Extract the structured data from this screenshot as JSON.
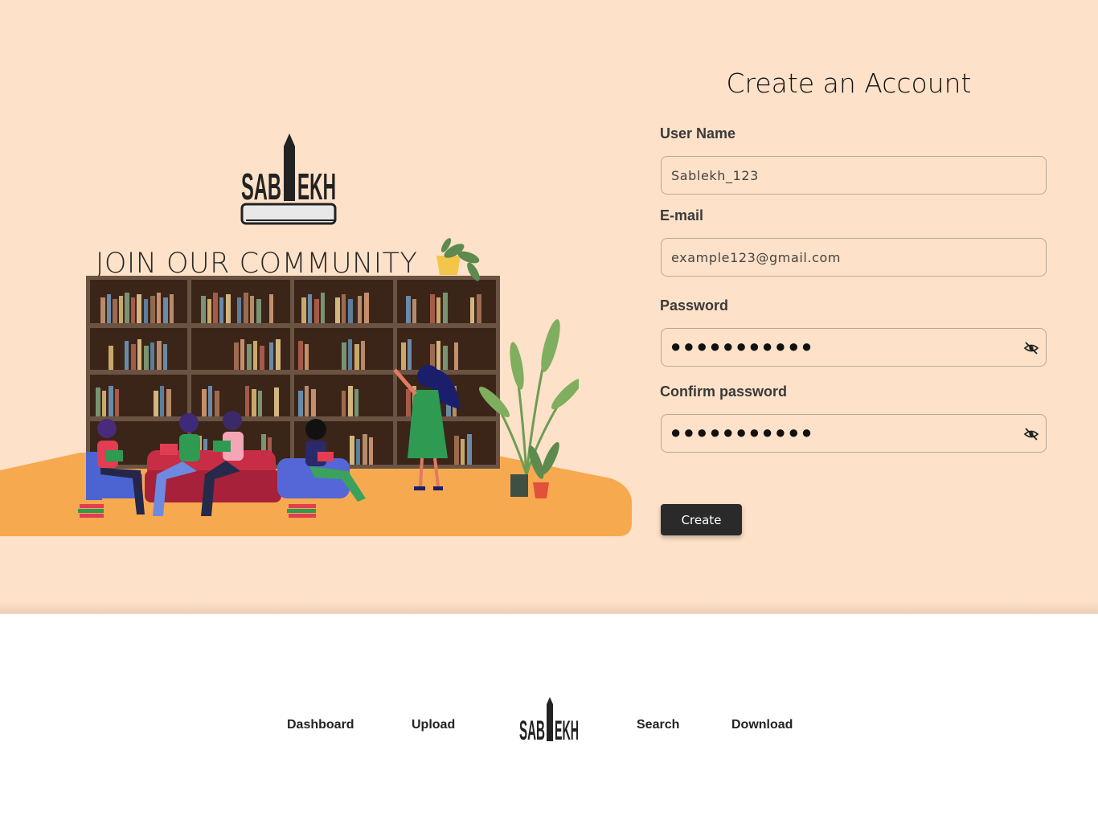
{
  "hero": {
    "tagline": "JOIN OUR COMMUNITY",
    "logo_text": "SABLEKH",
    "colors": {
      "background": "#fde1c8",
      "floor": "#f7a950"
    }
  },
  "form": {
    "title": "Create an Account",
    "username": {
      "label": "User Name",
      "value": "Sablekh_123"
    },
    "email": {
      "label": "E-mail",
      "value": "example123@gmail.com"
    },
    "password": {
      "label": "Password",
      "masked": "●●●●●●●●●●●",
      "toggle_icon": "eye-slash-icon"
    },
    "confirm_password": {
      "label": "Confirm password",
      "masked": "●●●●●●●●●●●",
      "toggle_icon": "eye-slash-icon"
    },
    "submit_label": "Create"
  },
  "footer": {
    "nav": [
      "Dashboard",
      "Upload",
      "Search",
      "Download"
    ],
    "logo_text": "SABLEKH"
  }
}
